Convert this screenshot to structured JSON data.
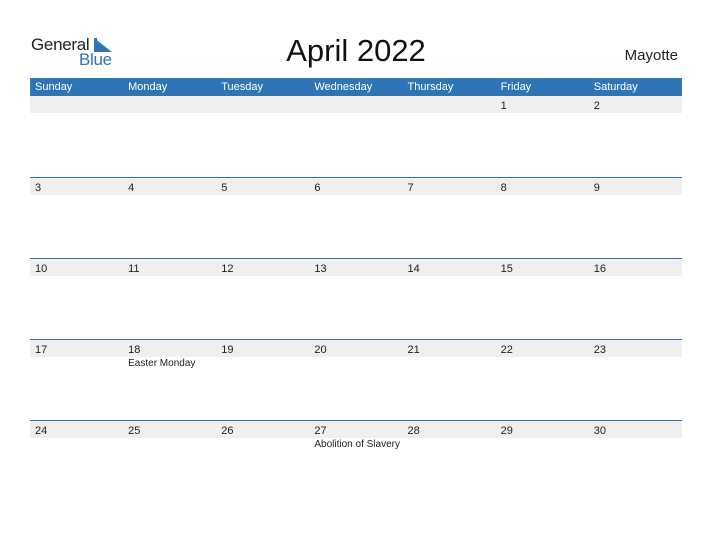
{
  "logo": {
    "line1": "General",
    "line2": "Blue"
  },
  "header": {
    "title": "April 2022",
    "region": "Mayotte"
  },
  "colors": {
    "accent": "#2e75b6",
    "band": "#efefef"
  },
  "weekdays": [
    "Sunday",
    "Monday",
    "Tuesday",
    "Wednesday",
    "Thursday",
    "Friday",
    "Saturday"
  ],
  "weeks": [
    [
      {
        "day": ""
      },
      {
        "day": ""
      },
      {
        "day": ""
      },
      {
        "day": ""
      },
      {
        "day": ""
      },
      {
        "day": "1"
      },
      {
        "day": "2"
      }
    ],
    [
      {
        "day": "3"
      },
      {
        "day": "4"
      },
      {
        "day": "5"
      },
      {
        "day": "6"
      },
      {
        "day": "7"
      },
      {
        "day": "8"
      },
      {
        "day": "9"
      }
    ],
    [
      {
        "day": "10"
      },
      {
        "day": "11"
      },
      {
        "day": "12"
      },
      {
        "day": "13"
      },
      {
        "day": "14"
      },
      {
        "day": "15"
      },
      {
        "day": "16"
      }
    ],
    [
      {
        "day": "17"
      },
      {
        "day": "18",
        "holiday": "Easter Monday"
      },
      {
        "day": "19"
      },
      {
        "day": "20"
      },
      {
        "day": "21"
      },
      {
        "day": "22"
      },
      {
        "day": "23"
      }
    ],
    [
      {
        "day": "24"
      },
      {
        "day": "25"
      },
      {
        "day": "26"
      },
      {
        "day": "27",
        "holiday": "Abolition of Slavery"
      },
      {
        "day": "28"
      },
      {
        "day": "29"
      },
      {
        "day": "30"
      }
    ]
  ]
}
